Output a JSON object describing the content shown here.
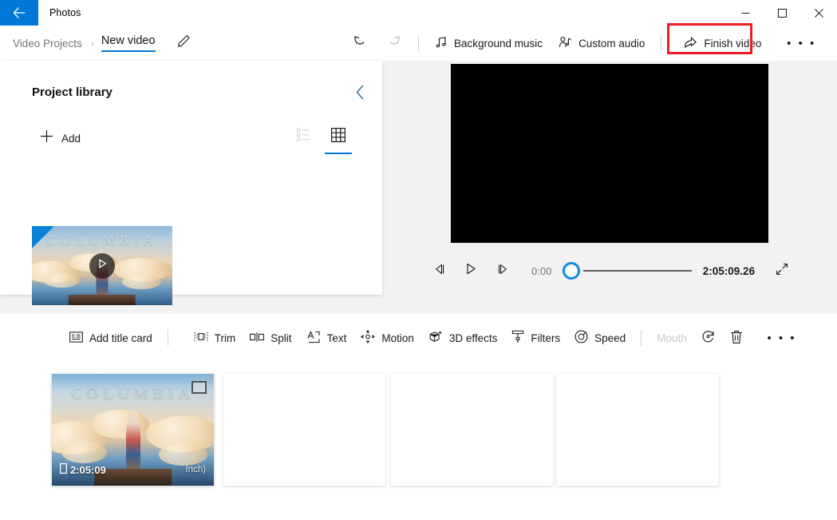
{
  "window": {
    "app_title": "Photos",
    "back_icon": "back-arrow-icon",
    "minimize_label": "─",
    "maximize_label": "□",
    "close_label": "✕"
  },
  "breadcrumb": {
    "parent": "Video Projects",
    "separator": "›",
    "current": "New video",
    "rename_icon": "pencil-icon"
  },
  "command_bar": {
    "undo_icon": "undo-icon",
    "redo_icon": "redo-icon",
    "background_music": "Background music",
    "background_music_icon": "music-note-icon",
    "custom_audio": "Custom audio",
    "custom_audio_icon": "person-audio-icon",
    "finish_video": "Finish video",
    "finish_video_icon": "share-icon",
    "overflow": "• • •",
    "highlight_color": "#ee1c25"
  },
  "library": {
    "title": "Project library",
    "collapse_icon": "chevron-left-icon",
    "add_label": "Add",
    "add_icon": "plus-icon",
    "list_view_icon": "list-view-icon",
    "grid_view_icon": "grid-view-icon",
    "active_view": "grid",
    "items": [
      {
        "title_text": "COLUMBIA",
        "play_icon": "play-icon",
        "selected": true
      }
    ]
  },
  "preview": {
    "prev_frame_icon": "previous-frame-icon",
    "play_icon": "play-icon",
    "next_frame_icon": "next-frame-icon",
    "current_time": "0:00",
    "total_time": "2:05:09.26",
    "progress_percent": 0,
    "expand_icon": "expand-icon",
    "video_background": "#000000"
  },
  "edit_toolbar": {
    "tools": [
      {
        "label": "Add title card",
        "icon": "title-card-icon",
        "disabled": false
      },
      {
        "label": "Trim",
        "icon": "trim-icon",
        "disabled": false
      },
      {
        "label": "Split",
        "icon": "split-icon",
        "disabled": false
      },
      {
        "label": "Text",
        "icon": "text-icon",
        "disabled": false
      },
      {
        "label": "Motion",
        "icon": "motion-icon",
        "disabled": false
      },
      {
        "label": "3D effects",
        "icon": "three-d-effects-icon",
        "disabled": false
      },
      {
        "label": "Filters",
        "icon": "filters-icon",
        "disabled": false
      },
      {
        "label": "Speed",
        "icon": "speed-icon",
        "disabled": false
      },
      {
        "label": "Mouth",
        "icon": "mouth-icon",
        "disabled": true
      }
    ],
    "rotate_icon": "rotate-icon",
    "delete_icon": "trash-icon",
    "overflow": "• • •"
  },
  "storyboard": {
    "items": [
      {
        "filled": true,
        "title_text": "COLUMBIA",
        "duration": "2:05:09",
        "corner_note": "Inch)",
        "selected": true,
        "badge_icon": "resize-badge-icon",
        "duration_icon": "clip-icon"
      },
      {
        "filled": false
      },
      {
        "filled": false
      },
      {
        "filled": false
      }
    ],
    "selection_color": "#0a84d8"
  }
}
